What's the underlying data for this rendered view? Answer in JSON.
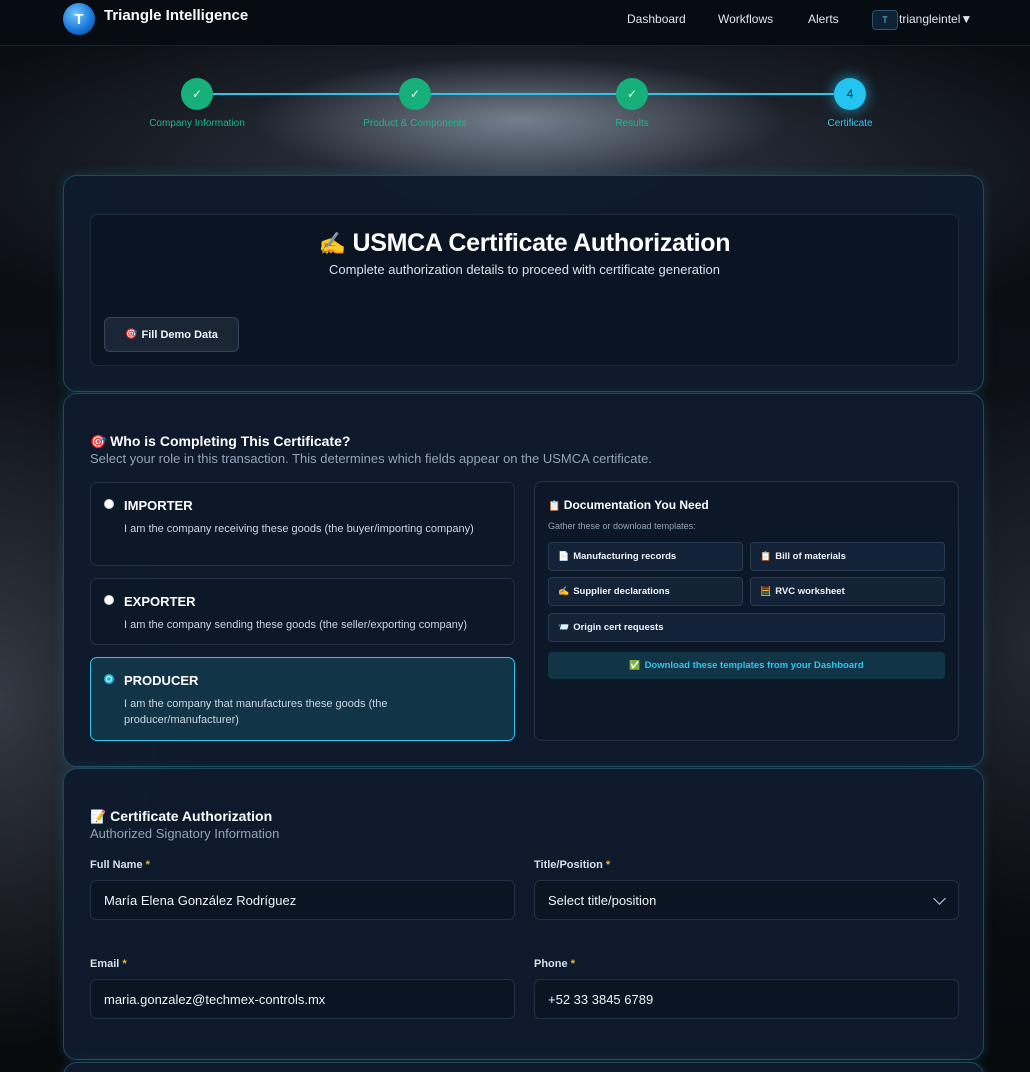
{
  "nav": {
    "brand": "Triangle Intelligence",
    "logo_letter": "T",
    "links": [
      "Dashboard",
      "Workflows",
      "Alerts"
    ],
    "user_initial": "T",
    "user_name": "triangleintel▼"
  },
  "stepper": {
    "steps": [
      {
        "label": "Company Information",
        "mark": "✓",
        "state": "done"
      },
      {
        "label": "Product & Components",
        "mark": "✓",
        "state": "done"
      },
      {
        "label": "Results",
        "mark": "✓",
        "state": "done"
      },
      {
        "label": "Certificate",
        "mark": "4",
        "state": "active"
      }
    ]
  },
  "header_card": {
    "icon": "✍️",
    "title": "USMCA Certificate Authorization",
    "subtitle": "Complete authorization details to proceed with certificate generation",
    "demo_icon": "🎯",
    "demo_button": "Fill Demo Data"
  },
  "role_section": {
    "icon": "🎯",
    "title": "Who is Completing This Certificate?",
    "subtitle": "Select your role in this transaction. This determines which fields appear on the USMCA certificate.",
    "roles": [
      {
        "title": "IMPORTER",
        "desc": "I am the company receiving these goods (the buyer/importing company)",
        "selected": false
      },
      {
        "title": "EXPORTER",
        "desc": "I am the company sending these goods (the seller/exporting company)",
        "selected": false
      },
      {
        "title": "PRODUCER",
        "desc": "I am the company that manufactures these goods (the producer/manufacturer)",
        "selected": true
      }
    ],
    "docs": {
      "icon": "📋",
      "title": "Documentation You Need",
      "subtitle": "Gather these or download templates:",
      "items": [
        {
          "icon": "📄",
          "label": "Manufacturing records"
        },
        {
          "icon": "📋",
          "label": "Bill of materials"
        },
        {
          "icon": "✍️",
          "label": "Supplier declarations"
        },
        {
          "icon": "🧮",
          "label": "RVC worksheet"
        },
        {
          "icon": "📨",
          "label": "Origin cert requests"
        }
      ],
      "download_icon": "✅",
      "download_label": "Download these templates from your Dashboard"
    }
  },
  "auth_section": {
    "icon": "📝",
    "title": "Certificate Authorization",
    "subtitle": "Authorized Signatory Information",
    "fields": {
      "full_name": {
        "label": "Full Name",
        "value": "María Elena González Rodríguez"
      },
      "title_position": {
        "label": "Title/Position",
        "value": "Select title/position"
      },
      "email": {
        "label": "Email",
        "value": "maria.gonzalez@techmex-controls.mx"
      },
      "phone": {
        "label": "Phone",
        "value": "+52 33 3845 6789"
      }
    },
    "required_mark": "*"
  }
}
